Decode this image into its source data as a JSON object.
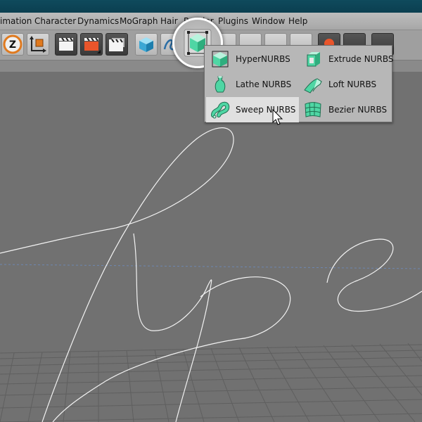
{
  "menubar": {
    "items": [
      "imation",
      "Character",
      "Dynamics",
      "MoGraph",
      "Hair",
      "Render",
      "Plugins",
      "Window",
      "Help"
    ]
  },
  "toolbar": {
    "buttons": [
      {
        "name": "z-icon"
      },
      {
        "name": "axis-icon"
      },
      {
        "name": "clapper-icon"
      },
      {
        "name": "clapper-red-icon"
      },
      {
        "name": "clapper-multi-icon"
      },
      {
        "name": "cube-icon"
      },
      {
        "name": "spline-icon"
      },
      {
        "name": "nurbs-icon"
      }
    ]
  },
  "dropdown": {
    "items": [
      {
        "label": "HyperNURBS",
        "icon": "hypernurbs-icon",
        "selected": false
      },
      {
        "label": "Extrude NURBS",
        "icon": "extrude-nurbs-icon",
        "selected": false
      },
      {
        "label": "Lathe NURBS",
        "icon": "lathe-nurbs-icon",
        "selected": false
      },
      {
        "label": "Loft NURBS",
        "icon": "loft-nurbs-icon",
        "selected": false
      },
      {
        "label": "Sweep NURBS",
        "icon": "sweep-nurbs-icon",
        "selected": true
      },
      {
        "label": "Bezier NURBS",
        "icon": "bezier-nurbs-icon",
        "selected": false
      }
    ]
  },
  "colors": {
    "viewport_bg": "#717171",
    "spline": "#ffffff",
    "nurbs_green": "#4fd6a4",
    "selected_row": "#e0e0e0",
    "titlebar": "#0f4a5c"
  }
}
